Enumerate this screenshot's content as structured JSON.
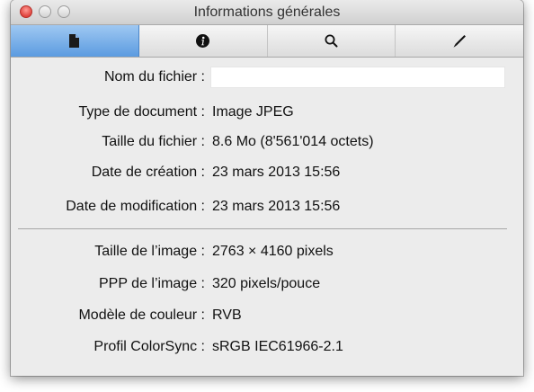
{
  "window": {
    "title": "Informations générales"
  },
  "toolbar": {
    "tabs": [
      {
        "icon": "document-icon",
        "active": true
      },
      {
        "icon": "info-icon",
        "active": false
      },
      {
        "icon": "search-icon",
        "active": false
      },
      {
        "icon": "pen-icon",
        "active": false
      }
    ]
  },
  "fields": {
    "filename": {
      "label": "Nom du fichier :",
      "value": ""
    },
    "doctype": {
      "label": "Type de document :",
      "value": "Image JPEG"
    },
    "filesize": {
      "label": "Taille du fichier :",
      "value": "8.6 Mo (8'561'014 octets)"
    },
    "created": {
      "label": "Date de création :",
      "value": "23 mars 2013 15:56"
    },
    "modified": {
      "label": "Date de modification :",
      "value": "23 mars 2013 15:56"
    },
    "imagesize": {
      "label": "Taille de l’image :",
      "value": "2763 × 4160 pixels"
    },
    "dpi": {
      "label": "PPP de l’image :",
      "value": "320 pixels/pouce"
    },
    "colormodel": {
      "label": "Modèle de couleur :",
      "value": "RVB"
    },
    "colorsync": {
      "label": "Profil ColorSync :",
      "value": "sRGB IEC61966-2.1"
    }
  },
  "colors": {
    "active_tab": "#5b9be0",
    "close_button": "#e0443e",
    "window_bg": "#ececec"
  }
}
